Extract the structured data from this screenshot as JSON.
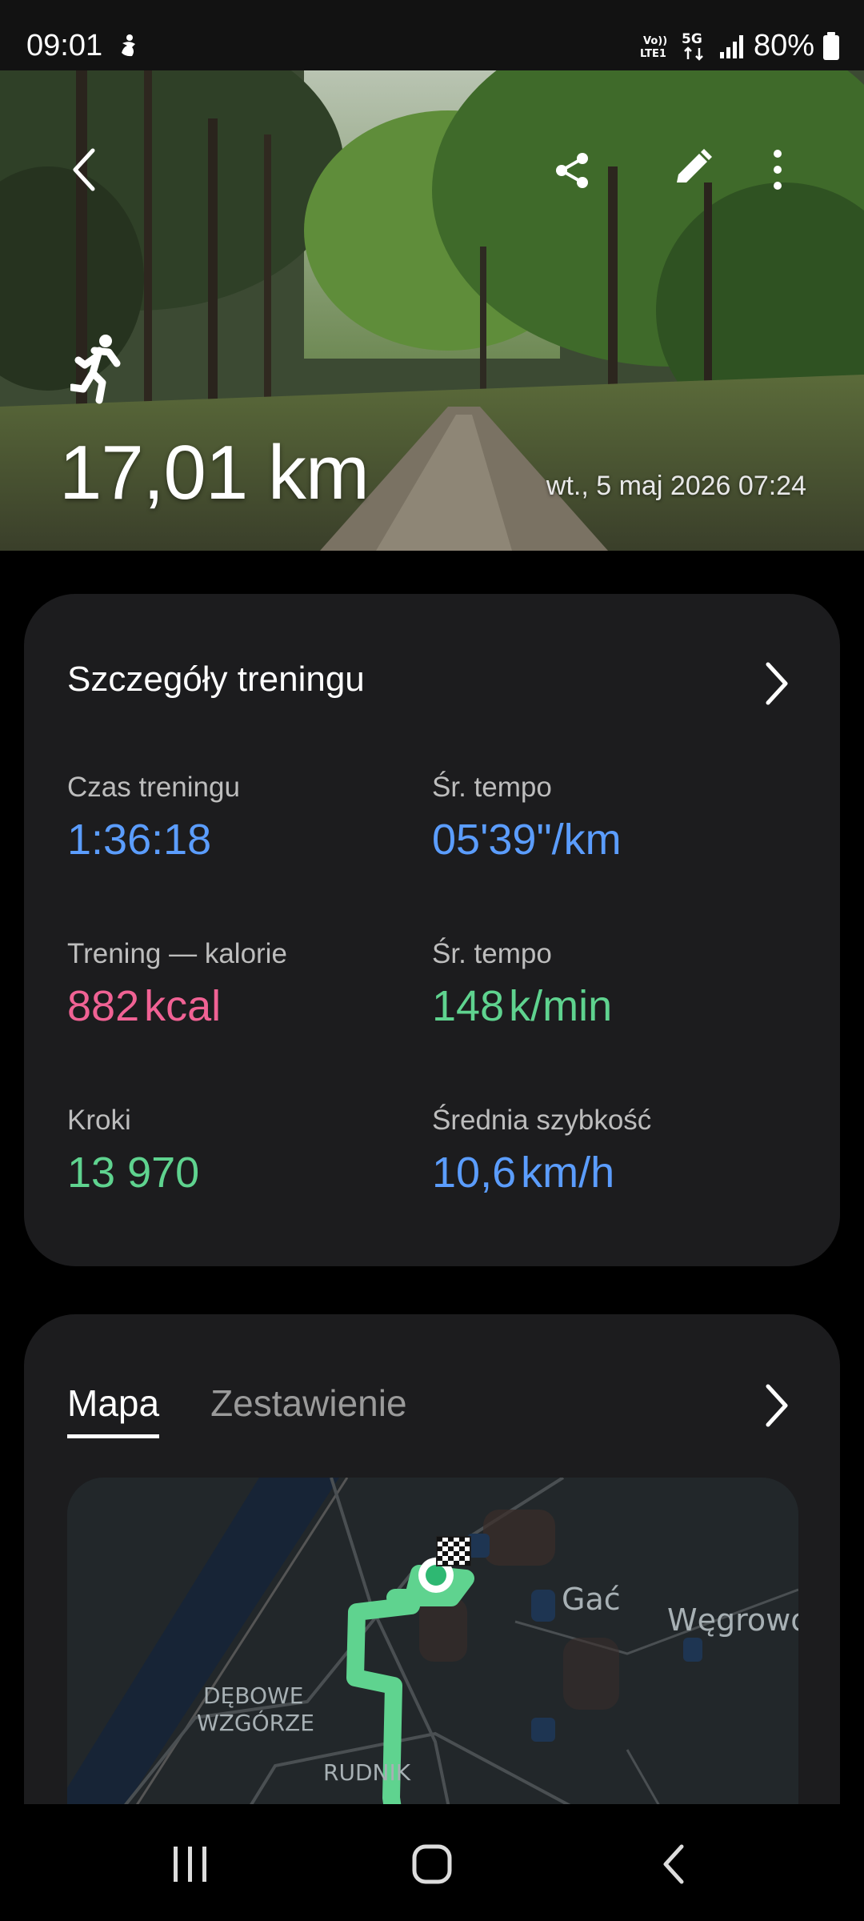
{
  "status_bar": {
    "time": "09:01",
    "network": "5G",
    "volte": "Vo)) LTE1",
    "battery": "80%"
  },
  "hero": {
    "distance": "17,01 km",
    "date": "wt., 5 maj 2026 07:24",
    "activity_icon": "running-icon"
  },
  "details": {
    "title": "Szczegóły treningu",
    "metrics": [
      {
        "label": "Czas treningu",
        "value": "1:36:18",
        "unit": "",
        "color": "#5b9dff"
      },
      {
        "label": "Śr. tempo",
        "value": "05'39\"",
        "unit": "/km",
        "color": "#5b9dff"
      },
      {
        "label": "Trening — kalorie",
        "value": "882",
        "unit": "kcal",
        "color": "#f06294"
      },
      {
        "label": "Śr. tempo",
        "value": "148",
        "unit": "k/min",
        "color": "#5fd38f"
      },
      {
        "label": "Kroki",
        "value": "13 970",
        "unit": "",
        "color": "#5fd38f"
      },
      {
        "label": "Średnia szybkość",
        "value": "10,6",
        "unit": "km/h",
        "color": "#5b9dff"
      }
    ]
  },
  "map_section": {
    "tabs": [
      {
        "label": "Mapa",
        "active": true
      },
      {
        "label": "Zestawienie",
        "active": false
      }
    ],
    "map_labels": {
      "gac": "Gać",
      "wegrowo": "Węgrowo",
      "debowe": "DĘBOWE",
      "wzgorze": "WZGÓRZE",
      "rudnik": "RUDNIK"
    },
    "route_color": "#5fd38f"
  }
}
